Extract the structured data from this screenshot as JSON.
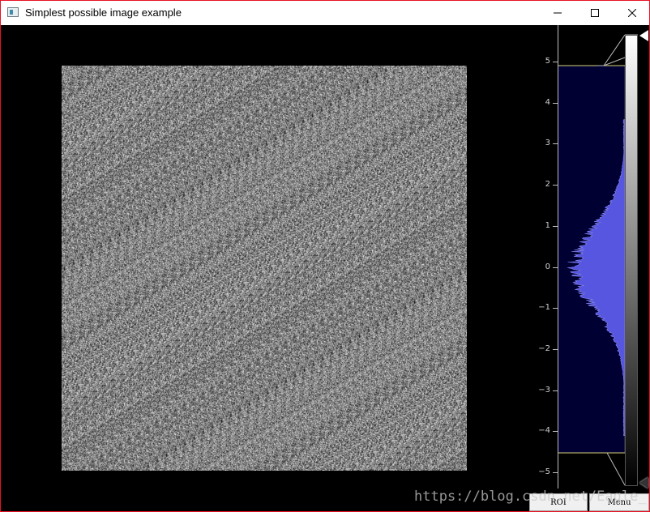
{
  "window": {
    "title": "Simplest possible image example",
    "minimize_icon": "minimize-icon",
    "maximize_icon": "maximize-icon",
    "close_icon": "close-icon"
  },
  "histogram": {
    "axis_ticks": [
      "5",
      "4",
      "3",
      "2",
      "1",
      "0",
      "−1",
      "−2",
      "−3",
      "−4",
      "−5"
    ],
    "panel_color": "#000033",
    "bar_color": "#5656e0",
    "level_line_color": "#d8d47a"
  },
  "buttons": {
    "roi_label": "ROI",
    "menu_label": "Menu"
  },
  "watermark": "https://blog.csdn.net/Eagle_"
}
